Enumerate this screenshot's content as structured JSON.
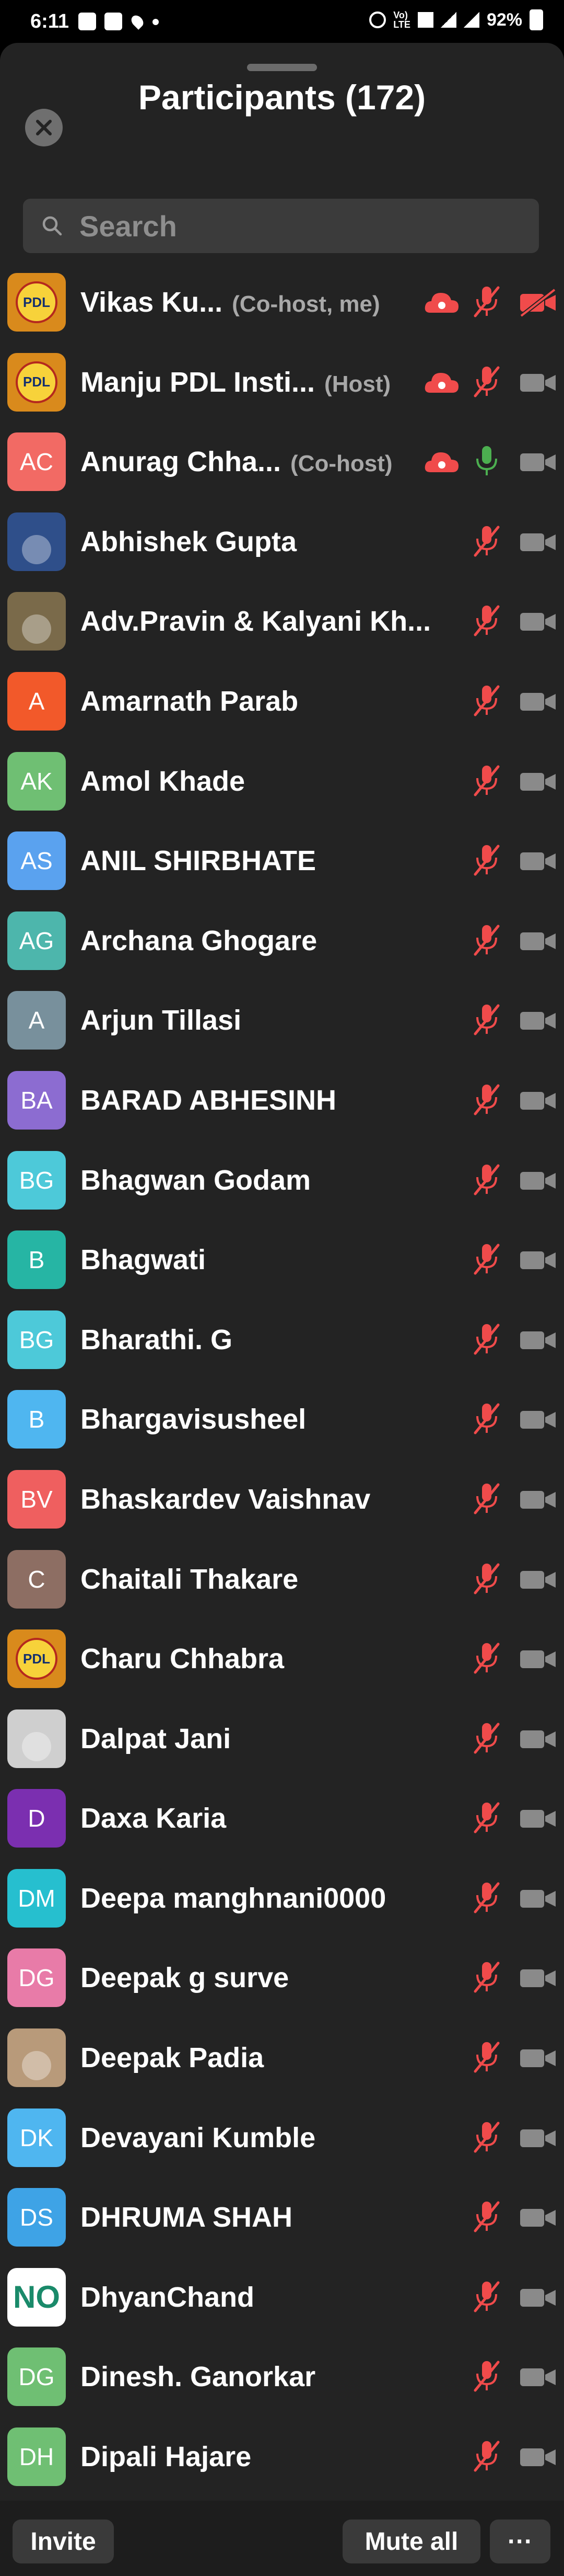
{
  "status": {
    "time": "6:11",
    "battery": "92%"
  },
  "header": {
    "title": "Participants (172)"
  },
  "search": {
    "placeholder": "Search"
  },
  "colors": {
    "muted_red": "#f04b4b",
    "sheet_bg": "#232323",
    "cam_gray": "#8a8a8a",
    "mic_green": "#4caf50"
  },
  "participants": [
    {
      "name": "Vikas Ku...",
      "role": "(Co-host, me)",
      "avatar": "PDL",
      "avatar_color": "#d98a1c",
      "cloud": true,
      "mic": "muted",
      "cam": "off_red"
    },
    {
      "name": "Manju PDL Insti...",
      "role": "(Host)",
      "avatar": "PDL",
      "avatar_color": "#d98a1c",
      "cloud": true,
      "mic": "muted",
      "cam": "off"
    },
    {
      "name": "Anurag Chha...",
      "role": "(Co-host)",
      "avatar": "AC",
      "avatar_color": "#f26a64",
      "cloud": true,
      "mic": "on",
      "cam": "off"
    },
    {
      "name": "Abhishek Gupta",
      "role": "",
      "avatar": "",
      "avatar_color": "#2f4f8a",
      "cloud": false,
      "mic": "muted",
      "cam": "off"
    },
    {
      "name": "Adv.Pravin & Kalyani Kh...",
      "role": "",
      "avatar": "",
      "avatar_color": "#7a6a4a",
      "cloud": false,
      "mic": "muted",
      "cam": "off"
    },
    {
      "name": "Amarnath Parab",
      "role": "",
      "avatar": "A",
      "avatar_color": "#f2592a",
      "cloud": false,
      "mic": "muted",
      "cam": "off"
    },
    {
      "name": "Amol Khade",
      "role": "",
      "avatar": "AK",
      "avatar_color": "#6fbf73",
      "cloud": false,
      "mic": "muted",
      "cam": "off"
    },
    {
      "name": "ANIL SHIRBHATE",
      "role": "",
      "avatar": "AS",
      "avatar_color": "#5aa2ef",
      "cloud": false,
      "mic": "muted",
      "cam": "off"
    },
    {
      "name": "Archana Ghogare",
      "role": "",
      "avatar": "AG",
      "avatar_color": "#4db6ac",
      "cloud": false,
      "mic": "muted",
      "cam": "off"
    },
    {
      "name": "Arjun Tillasi",
      "role": "",
      "avatar": "A",
      "avatar_color": "#78909c",
      "cloud": false,
      "mic": "muted",
      "cam": "off"
    },
    {
      "name": "BARAD ABHESINH",
      "role": "",
      "avatar": "BA",
      "avatar_color": "#8c6cd1",
      "cloud": false,
      "mic": "muted",
      "cam": "off"
    },
    {
      "name": "Bhagwan Godam",
      "role": "",
      "avatar": "BG",
      "avatar_color": "#4dc9d9",
      "cloud": false,
      "mic": "muted",
      "cam": "off"
    },
    {
      "name": "Bhagwati",
      "role": "",
      "avatar": "B",
      "avatar_color": "#26b5a4",
      "cloud": false,
      "mic": "muted",
      "cam": "off"
    },
    {
      "name": "Bharathi. G",
      "role": "",
      "avatar": "BG",
      "avatar_color": "#4dc9d9",
      "cloud": false,
      "mic": "muted",
      "cam": "off"
    },
    {
      "name": "Bhargavisusheel",
      "role": "",
      "avatar": "B",
      "avatar_color": "#4fb6f0",
      "cloud": false,
      "mic": "muted",
      "cam": "off"
    },
    {
      "name": "Bhaskardev Vaishnav",
      "role": "",
      "avatar": "BV",
      "avatar_color": "#ef5f5f",
      "cloud": false,
      "mic": "muted",
      "cam": "off"
    },
    {
      "name": "Chaitali Thakare",
      "role": "",
      "avatar": "C",
      "avatar_color": "#8d6e63",
      "cloud": false,
      "mic": "muted",
      "cam": "off"
    },
    {
      "name": "Charu Chhabra",
      "role": "",
      "avatar": "PDL",
      "avatar_color": "#d98a1c",
      "cloud": false,
      "mic": "muted",
      "cam": "off"
    },
    {
      "name": "Dalpat Jani",
      "role": "",
      "avatar": "",
      "avatar_color": "#cfcfcf",
      "cloud": false,
      "mic": "muted",
      "cam": "off"
    },
    {
      "name": "Daxa Karia",
      "role": "",
      "avatar": "D",
      "avatar_color": "#7b2fb0",
      "cloud": false,
      "mic": "muted",
      "cam": "off"
    },
    {
      "name": "Deepa manghnani0000",
      "role": "",
      "avatar": "DM",
      "avatar_color": "#26bfcf",
      "cloud": false,
      "mic": "muted",
      "cam": "off"
    },
    {
      "name": "Deepak g surve",
      "role": "",
      "avatar": "DG",
      "avatar_color": "#e87ba8",
      "cloud": false,
      "mic": "muted",
      "cam": "off"
    },
    {
      "name": "Deepak Padia",
      "role": "",
      "avatar": "",
      "avatar_color": "#b89a7a",
      "cloud": false,
      "mic": "muted",
      "cam": "off"
    },
    {
      "name": "Devayani Kumble",
      "role": "",
      "avatar": "DK",
      "avatar_color": "#4fb6f0",
      "cloud": false,
      "mic": "muted",
      "cam": "off"
    },
    {
      "name": "DHRUMA SHAH",
      "role": "",
      "avatar": "DS",
      "avatar_color": "#3ea3e6",
      "cloud": false,
      "mic": "muted",
      "cam": "off"
    },
    {
      "name": "DhyanChand",
      "role": "",
      "avatar": "NO",
      "avatar_color": "#ffffff",
      "cloud": false,
      "mic": "muted",
      "cam": "off"
    },
    {
      "name": "Dinesh. Ganorkar",
      "role": "",
      "avatar": "DG",
      "avatar_color": "#6fbf73",
      "cloud": false,
      "mic": "muted",
      "cam": "off"
    },
    {
      "name": "Dipali Hajare",
      "role": "",
      "avatar": "DH",
      "avatar_color": "#6fbf73",
      "cloud": false,
      "mic": "muted",
      "cam": "off"
    }
  ],
  "footer": {
    "invite": "Invite",
    "mute_all": "Mute all",
    "more": "···"
  }
}
